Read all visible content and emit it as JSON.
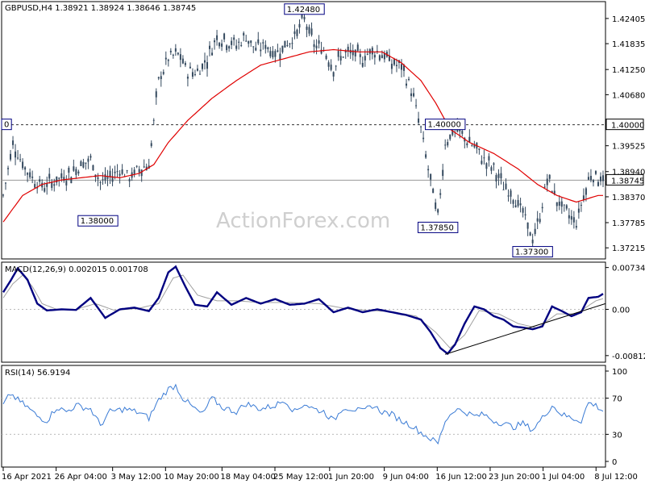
{
  "chart_data": [
    {
      "type": "candlestick",
      "title": "GBPUSD,H4  1.38921 1.38924 1.38646 1.38745",
      "symbol": "GBPUSD",
      "timeframe": "H4",
      "ylim": [
        1.37,
        1.4275
      ],
      "yticks": [
        "1.42405",
        "1.41835",
        "1.41250",
        "1.40680",
        "1.39525",
        "1.38940",
        "1.38370",
        "1.37785",
        "1.37215"
      ],
      "horizontal_line": {
        "value": 1.4,
        "label": "1.40000"
      },
      "current_price": {
        "value": 1.38745,
        "label": "1.38745"
      },
      "annotations": [
        {
          "label": "1.42480",
          "value": 1.4248,
          "bar": 124
        },
        {
          "label": "1.38000",
          "value": 1.38,
          "bar": 39
        },
        {
          "label": "1.37850",
          "value": 1.3785,
          "bar": 179
        },
        {
          "label": "1.40000",
          "value": 1.4,
          "bar": 182
        },
        {
          "label": "1.37300",
          "value": 1.373,
          "bar": 218
        },
        {
          "label": "0",
          "value": 1.4,
          "bar": 0
        }
      ],
      "ma_color": "#e00000",
      "candle_color": "#34495e",
      "series": [
        {
          "name": "price",
          "keypoints": [
            [
              0,
              1.384
            ],
            [
              4,
              1.396
            ],
            [
              8,
              1.391
            ],
            [
              12,
              1.388
            ],
            [
              16,
              1.386
            ],
            [
              20,
              1.387
            ],
            [
              24,
              1.388
            ],
            [
              28,
              1.389
            ],
            [
              32,
              1.391
            ],
            [
              36,
              1.392
            ],
            [
              40,
              1.387
            ],
            [
              44,
              1.388
            ],
            [
              48,
              1.39
            ],
            [
              52,
              1.388
            ],
            [
              56,
              1.39
            ],
            [
              60,
              1.391
            ],
            [
              64,
              1.41
            ],
            [
              68,
              1.415
            ],
            [
              72,
              1.416
            ],
            [
              76,
              1.412
            ],
            [
              80,
              1.412
            ],
            [
              84,
              1.415
            ],
            [
              88,
              1.42
            ],
            [
              92,
              1.419
            ],
            [
              96,
              1.418
            ],
            [
              100,
              1.42
            ],
            [
              104,
              1.417
            ],
            [
              108,
              1.418
            ],
            [
              112,
              1.416
            ],
            [
              116,
              1.418
            ],
            [
              120,
              1.42
            ],
            [
              124,
              1.424
            ],
            [
              128,
              1.418
            ],
            [
              132,
              1.417
            ],
            [
              136,
              1.413
            ],
            [
              140,
              1.416
            ],
            [
              144,
              1.416
            ],
            [
              148,
              1.415
            ],
            [
              152,
              1.417
            ],
            [
              156,
              1.416
            ],
            [
              160,
              1.414
            ],
            [
              164,
              1.413
            ],
            [
              168,
              1.408
            ],
            [
              172,
              1.399
            ],
            [
              176,
              1.387
            ],
            [
              179,
              1.379
            ],
            [
              182,
              1.396
            ],
            [
              186,
              1.399
            ],
            [
              190,
              1.397
            ],
            [
              194,
              1.395
            ],
            [
              198,
              1.392
            ],
            [
              202,
              1.39
            ],
            [
              206,
              1.386
            ],
            [
              210,
              1.384
            ],
            [
              214,
              1.38
            ],
            [
              218,
              1.374
            ],
            [
              221,
              1.379
            ],
            [
              224,
              1.388
            ],
            [
              228,
              1.383
            ],
            [
              232,
              1.38
            ],
            [
              236,
              1.378
            ],
            [
              239,
              1.384
            ],
            [
              242,
              1.389
            ],
            [
              245,
              1.388
            ]
          ]
        },
        {
          "name": "MA",
          "keypoints": [
            [
              0,
              1.378
            ],
            [
              8,
              1.384
            ],
            [
              16,
              1.3865
            ],
            [
              24,
              1.3875
            ],
            [
              32,
              1.388
            ],
            [
              40,
              1.3885
            ],
            [
              48,
              1.388
            ],
            [
              56,
              1.389
            ],
            [
              62,
              1.391
            ],
            [
              68,
              1.396
            ],
            [
              76,
              1.401
            ],
            [
              86,
              1.406
            ],
            [
              96,
              1.41
            ],
            [
              106,
              1.4135
            ],
            [
              116,
              1.415
            ],
            [
              126,
              1.4165
            ],
            [
              136,
              1.417
            ],
            [
              146,
              1.4165
            ],
            [
              156,
              1.4165
            ],
            [
              164,
              1.414
            ],
            [
              172,
              1.41
            ],
            [
              178,
              1.405
            ],
            [
              184,
              1.399
            ],
            [
              192,
              1.396
            ],
            [
              202,
              1.3935
            ],
            [
              212,
              1.39
            ],
            [
              220,
              1.3865
            ],
            [
              228,
              1.384
            ],
            [
              236,
              1.3825
            ],
            [
              245,
              1.384
            ]
          ]
        }
      ]
    },
    {
      "type": "line",
      "title": "MACD(12,26,9) 0.002015 0.001708",
      "ylim": [
        -0.009,
        0.008
      ],
      "yticks": [
        "0.007342",
        "0.00",
        "-0.008126"
      ],
      "trendline": {
        "from": [
          182,
          -0.0079
        ],
        "to": [
          254,
          0.001
        ]
      },
      "series": [
        {
          "name": "MACD",
          "color": "#000080",
          "keypoints": [
            [
              0,
              0.003
            ],
            [
              3,
              0.005
            ],
            [
              6,
              0.0072
            ],
            [
              10,
              0.0052
            ],
            [
              14,
              0.001
            ],
            [
              18,
              -0.0002
            ],
            [
              24,
              0.0
            ],
            [
              30,
              -0.0001
            ],
            [
              36,
              0.002
            ],
            [
              42,
              -0.0015
            ],
            [
              48,
              0.0
            ],
            [
              54,
              0.0003
            ],
            [
              60,
              -0.0003
            ],
            [
              64,
              0.002
            ],
            [
              68,
              0.0065
            ],
            [
              71,
              0.0075
            ],
            [
              75,
              0.004
            ],
            [
              79,
              0.0008
            ],
            [
              84,
              0.0005
            ],
            [
              88,
              0.003
            ],
            [
              94,
              0.0008
            ],
            [
              100,
              0.002
            ],
            [
              106,
              0.001
            ],
            [
              112,
              0.0018
            ],
            [
              118,
              0.0008
            ],
            [
              124,
              0.001
            ],
            [
              130,
              0.0018
            ],
            [
              136,
              -0.0005
            ],
            [
              142,
              0.0003
            ],
            [
              148,
              -0.0005
            ],
            [
              154,
              0.0
            ],
            [
              160,
              -0.0005
            ],
            [
              166,
              -0.001
            ],
            [
              172,
              -0.0018
            ],
            [
              176,
              -0.004
            ],
            [
              180,
              -0.0068
            ],
            [
              183,
              -0.0078
            ],
            [
              186,
              -0.0062
            ],
            [
              190,
              -0.0025
            ],
            [
              194,
              0.0005
            ],
            [
              198,
              0.0
            ],
            [
              202,
              -0.0012
            ],
            [
              206,
              -0.0018
            ],
            [
              210,
              -0.003
            ],
            [
              214,
              -0.0032
            ],
            [
              218,
              -0.0035
            ],
            [
              222,
              -0.003
            ],
            [
              226,
              0.0005
            ],
            [
              230,
              -0.0003
            ],
            [
              234,
              -0.0012
            ],
            [
              238,
              -0.0005
            ],
            [
              241,
              0.002
            ],
            [
              245,
              0.0022
            ],
            [
              248,
              0.003
            ]
          ]
        },
        {
          "name": "Signal",
          "color": "#a0a0a0",
          "keypoints": [
            [
              0,
              0.002
            ],
            [
              4,
              0.0045
            ],
            [
              8,
              0.006
            ],
            [
              12,
              0.004
            ],
            [
              16,
              0.001
            ],
            [
              22,
              0.0
            ],
            [
              30,
              0.0
            ],
            [
              38,
              0.001
            ],
            [
              46,
              -0.0002
            ],
            [
              56,
              0.0002
            ],
            [
              64,
              0.001
            ],
            [
              70,
              0.0055
            ],
            [
              74,
              0.006
            ],
            [
              80,
              0.0025
            ],
            [
              88,
              0.0015
            ],
            [
              96,
              0.0015
            ],
            [
              106,
              0.0012
            ],
            [
              118,
              0.0012
            ],
            [
              130,
              0.001
            ],
            [
              140,
              0.0002
            ],
            [
              150,
              -0.0002
            ],
            [
              160,
              -0.0004
            ],
            [
              170,
              -0.0012
            ],
            [
              178,
              -0.004
            ],
            [
              184,
              -0.0068
            ],
            [
              190,
              -0.0045
            ],
            [
              196,
              -0.0002
            ],
            [
              204,
              -0.0008
            ],
            [
              212,
              -0.0025
            ],
            [
              220,
              -0.0033
            ],
            [
              228,
              -0.0008
            ],
            [
              236,
              -0.0008
            ],
            [
              244,
              0.0015
            ],
            [
              248,
              0.002
            ]
          ]
        }
      ]
    },
    {
      "type": "line",
      "title": "RSI(14) 56.9194",
      "ylim": [
        0,
        100
      ],
      "yticks": [
        "100",
        "70",
        "30",
        "0"
      ],
      "levels": [
        70,
        30
      ],
      "series": [
        {
          "name": "RSI",
          "color": "#3a7bd5",
          "keypoints": [
            [
              0,
              62
            ],
            [
              3,
              75
            ],
            [
              6,
              68
            ],
            [
              10,
              60
            ],
            [
              14,
              50
            ],
            [
              18,
              45
            ],
            [
              22,
              60
            ],
            [
              26,
              55
            ],
            [
              30,
              62
            ],
            [
              36,
              58
            ],
            [
              40,
              40
            ],
            [
              44,
              55
            ],
            [
              50,
              58
            ],
            [
              56,
              54
            ],
            [
              60,
              48
            ],
            [
              64,
              68
            ],
            [
              68,
              80
            ],
            [
              71,
              84
            ],
            [
              74,
              70
            ],
            [
              78,
              60
            ],
            [
              82,
              52
            ],
            [
              86,
              70
            ],
            [
              90,
              60
            ],
            [
              96,
              55
            ],
            [
              100,
              64
            ],
            [
              106,
              58
            ],
            [
              112,
              62
            ],
            [
              116,
              68
            ],
            [
              120,
              55
            ],
            [
              124,
              64
            ],
            [
              128,
              58
            ],
            [
              132,
              55
            ],
            [
              136,
              45
            ],
            [
              140,
              60
            ],
            [
              144,
              58
            ],
            [
              148,
              55
            ],
            [
              152,
              62
            ],
            [
              156,
              55
            ],
            [
              160,
              52
            ],
            [
              164,
              45
            ],
            [
              168,
              40
            ],
            [
              172,
              32
            ],
            [
              176,
              25
            ],
            [
              179,
              20
            ],
            [
              182,
              45
            ],
            [
              186,
              58
            ],
            [
              190,
              55
            ],
            [
              194,
              50
            ],
            [
              198,
              52
            ],
            [
              202,
              45
            ],
            [
              206,
              42
            ],
            [
              210,
              38
            ],
            [
              214,
              42
            ],
            [
              218,
              35
            ],
            [
              222,
              48
            ],
            [
              226,
              62
            ],
            [
              230,
              52
            ],
            [
              234,
              48
            ],
            [
              238,
              45
            ],
            [
              241,
              65
            ],
            [
              244,
              62
            ],
            [
              247,
              56
            ]
          ]
        }
      ]
    }
  ],
  "xaxis": {
    "labels": [
      "16 Apr 2021",
      "26 Apr 04:00",
      "3 May 12:00",
      "10 May 20:00",
      "18 May 04:00",
      "25 May 12:00",
      "1 Jun 20:00",
      "9 Jun 04:00",
      "16 Jun 12:00",
      "23 Jun 20:00",
      "1 Jul 04:00",
      "8 Jul 12:00"
    ],
    "label_bars": [
      0,
      30,
      62,
      92,
      124,
      154,
      185,
      216,
      246,
      276,
      306,
      336
    ]
  },
  "watermark": "ActionForex.com"
}
